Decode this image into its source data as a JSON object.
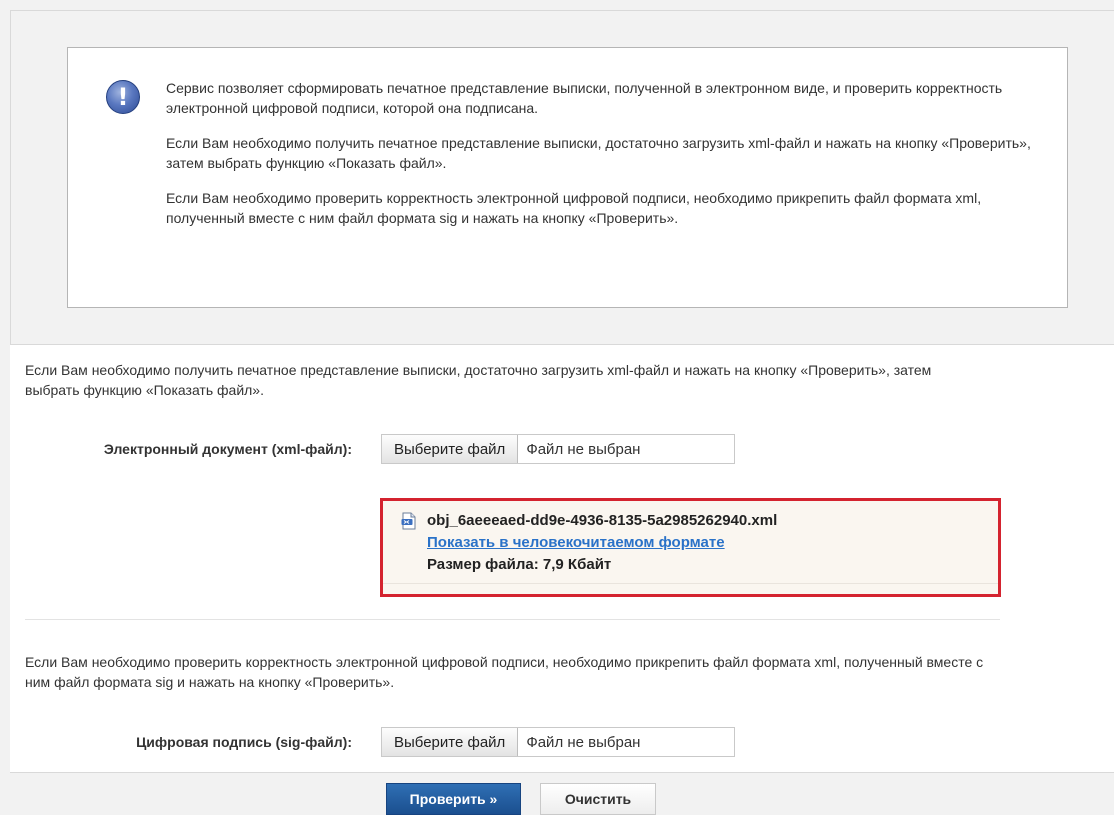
{
  "info": {
    "icon": "exclamation-icon",
    "paragraphs": [
      "Сервис позволяет сформировать печатное представление выписки, полученной в электронном виде, и проверить корректность электронной цифровой подписи, которой она подписана.",
      "Если Вам необходимо получить печатное представление выписки, достаточно загрузить xml-файл и нажать на кнопку «Проверить», затем выбрать функцию «Показать файл».",
      "Если Вам необходимо проверить корректность электронной цифровой подписи, необходимо прикрепить файл формата xml, полученный вместе с ним файл формата sig и нажать на кнопку «Проверить»."
    ]
  },
  "xml_section": {
    "text": "Если Вам необходимо получить печатное представление выписки, достаточно загрузить xml-файл и нажать на кнопку «Проверить», затем выбрать функцию «Показать файл».",
    "label": "Электронный документ (xml-файл):",
    "button": "Выберите файл",
    "status": "Файл не выбран"
  },
  "uploaded_file": {
    "icon": "xml-document-icon",
    "name": "obj_6aeeeaed-dd9e-4936-8135-5a2985262940.xml",
    "link": "Показать в человекочитаемом формате",
    "size": "Размер файла: 7,9 Кбайт",
    "highlight_color": "#d4232f"
  },
  "sig_section": {
    "text": "Если Вам необходимо проверить корректность электронной цифровой подписи, необходимо прикрепить файл формата xml, полученный вместе с ним файл формата sig и нажать на кнопку «Проверить».",
    "label": "Цифровая подпись (sig-файл):",
    "button": "Выберите файл",
    "status": "Файл не выбран"
  },
  "actions": {
    "check": "Проверить »",
    "clear": "Очистить",
    "accent_color": "#1f5799"
  }
}
